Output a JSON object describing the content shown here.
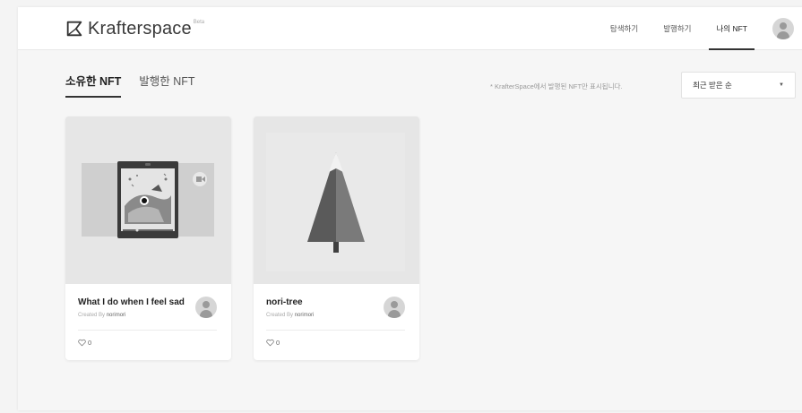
{
  "header": {
    "logo_text": "Krafterspace",
    "logo_beta": "Beta",
    "nav": [
      {
        "label": "탐색하기"
      },
      {
        "label": "발행하기"
      },
      {
        "label": "나의 NFT"
      }
    ]
  },
  "tabs": [
    {
      "label": "소유한 NFT"
    },
    {
      "label": "발행한 NFT"
    }
  ],
  "note": "* KrafterSpace에서 발행된 NFT만 표시됩니다.",
  "sort": {
    "selected": "최근 받은 순"
  },
  "cards": [
    {
      "title": "What I do when I feel sad",
      "created_prefix": "Created By",
      "creator": "norimori",
      "likes": "0",
      "image": "phone-illustration"
    },
    {
      "title": "nori-tree",
      "created_prefix": "Created By",
      "creator": "norimori",
      "likes": "0",
      "image": "tree-illustration"
    }
  ],
  "colors": {
    "accent": "#333333",
    "background": "#f6f6f6",
    "card": "#ffffff"
  }
}
